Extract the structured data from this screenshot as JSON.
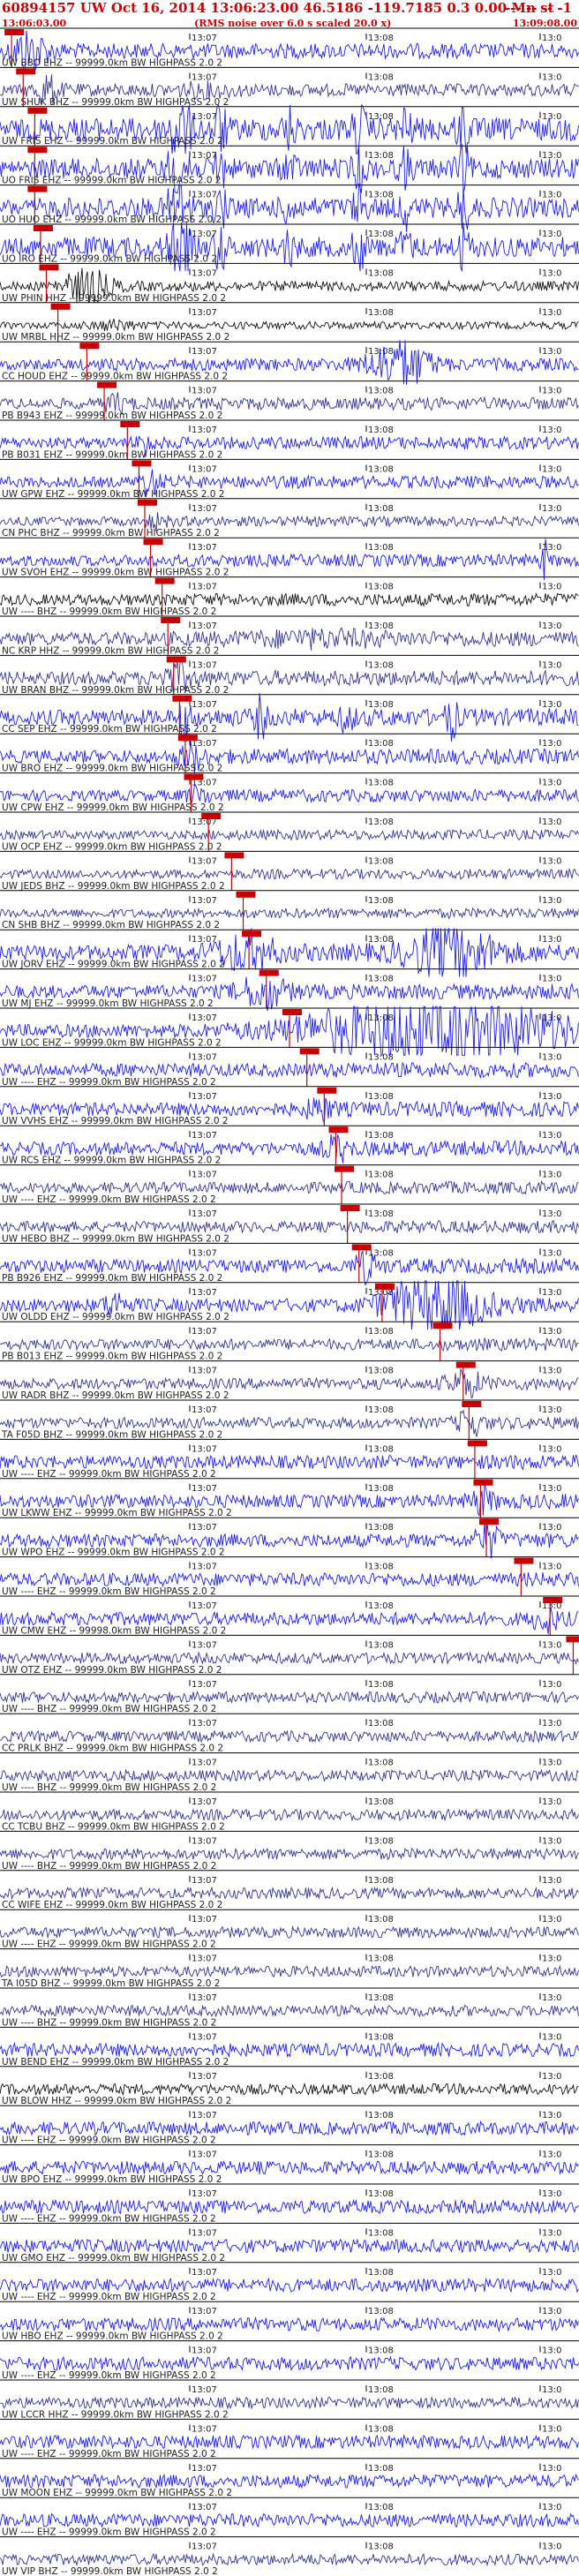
{
  "header": {
    "title": "60894157 UW Oct 16, 2014 13:06:23.00   46.5186 -119.7185  0.3 0.00 Mn st",
    "dashes": "--- -- --   -1",
    "start_time": "13:06:03.00",
    "rms_note": "(RMS noise over 6.0 s scaled 20.0 x)",
    "end_time": "13:09:08.00"
  },
  "chart_data": {
    "type": "seismogram",
    "title": "60894157 UW Oct 16, 2014 13:06:23.00   46.5186 -119.7185  0.3 0.00 Mn st",
    "x_start": "13:06:03.00",
    "x_end": "13:09:08.00",
    "tick_labels": [
      "13:07",
      "13:08",
      "13:0"
    ],
    "colors": {
      "blue": "#1a1aff",
      "navy": "#333399",
      "black": "#111111",
      "pick": "#cc0000"
    },
    "traces": [
      {
        "label": "UW BBO EHZ -- 99999.0km BW  HIGHPASS  2.0  2",
        "color": "blue",
        "amp": 0.6,
        "bursts": [
          [
            0.05,
            0.03,
            3.5
          ]
        ],
        "pick": 0.02
      },
      {
        "label": "UW SHUK BHZ -- 99999.0km BW  HIGHPASS  2.0  2",
        "color": "navy",
        "amp": 0.5,
        "bursts": [
          [
            0.08,
            0.02,
            3.0
          ],
          [
            0.35,
            0.05,
            1.6
          ]
        ],
        "pick": 0.04
      },
      {
        "label": "UW FRIS EHZ -- 99999.0km BW  HIGHPASS  2.0  2",
        "color": "blue",
        "amp": 0.9,
        "bursts": [
          [
            0.3,
            0.01,
            3.5
          ],
          [
            0.32,
            0.01,
            3.5
          ],
          [
            0.38,
            0.01,
            3.0
          ],
          [
            0.5,
            0.01,
            2.5
          ],
          [
            0.62,
            0.01,
            3.0
          ],
          [
            0.7,
            0.01,
            2.5
          ],
          [
            0.8,
            0.01,
            3.0
          ]
        ],
        "pick": 0.06
      },
      {
        "label": "UO FRIS EHZ -- 99999.0km BW  HIGHPASS  2.0  2",
        "color": "blue",
        "amp": 0.8,
        "bursts": [
          [
            0.3,
            0.01,
            3.5
          ],
          [
            0.32,
            0.01,
            3.5
          ],
          [
            0.38,
            0.01,
            3.0
          ],
          [
            0.5,
            0.01,
            2.5
          ],
          [
            0.62,
            0.01,
            3.0
          ],
          [
            0.7,
            0.01,
            2.5
          ],
          [
            0.8,
            0.01,
            3.0
          ]
        ],
        "pick": 0.06
      },
      {
        "label": "UO HUO EHZ -- 99999.0km BW  HIGHPASS  2.0  2",
        "color": "blue",
        "amp": 0.8,
        "bursts": [
          [
            0.3,
            0.01,
            3.5
          ],
          [
            0.32,
            0.01,
            3.5
          ],
          [
            0.38,
            0.01,
            3.0
          ],
          [
            0.5,
            0.01,
            2.5
          ],
          [
            0.62,
            0.01,
            3.0
          ],
          [
            0.7,
            0.01,
            2.5
          ],
          [
            0.8,
            0.01,
            3.0
          ]
        ],
        "pick": 0.06
      },
      {
        "label": "UO IRO EHZ -- 99999.0km BW  HIGHPASS  2.0  2",
        "color": "blue",
        "amp": 0.8,
        "bursts": [
          [
            0.3,
            0.01,
            3.5
          ],
          [
            0.32,
            0.01,
            3.5
          ],
          [
            0.38,
            0.01,
            3.0
          ],
          [
            0.5,
            0.01,
            2.5
          ],
          [
            0.62,
            0.01,
            3.0
          ],
          [
            0.7,
            0.01,
            2.5
          ],
          [
            0.8,
            0.01,
            3.0
          ]
        ],
        "pick": 0.07
      },
      {
        "label": "UW PHIN HHZ -- 99999.0km BW  HIGHPASS  2.0  2",
        "color": "black",
        "amp": 0.4,
        "bursts": [
          [
            0.15,
            0.04,
            4.0
          ]
        ],
        "pick": 0.08
      },
      {
        "label": "UW MRBL HHZ -- 99999.0km BW  HIGHPASS  2.0  2",
        "color": "black",
        "amp": 0.3,
        "bursts": [
          [
            0.2,
            0.03,
            2.0
          ]
        ],
        "pick": 0.1
      },
      {
        "label": "CC HOUD EHZ -- 99999.0km BW  HIGHPASS  2.0  2",
        "color": "blue",
        "amp": 0.5,
        "bursts": [
          [
            0.69,
            0.05,
            4.5
          ]
        ],
        "pick": 0.15
      },
      {
        "label": "PB B943 EHZ -- 99999.0km BW  HIGHPASS  2.0  2",
        "color": "navy",
        "amp": 0.5,
        "bursts": [
          [
            0.2,
            0.02,
            2.0
          ]
        ],
        "pick": 0.18
      },
      {
        "label": "PB B031 EHZ -- 99999.0km BW  HIGHPASS  2.0  2",
        "color": "blue",
        "amp": 0.5,
        "bursts": [
          [
            0.25,
            0.01,
            3.0
          ]
        ],
        "pick": 0.22
      },
      {
        "label": "UW GPW EHZ -- 99999.0km BW  HIGHPASS  2.0  2",
        "color": "blue",
        "amp": 0.5,
        "bursts": [
          [
            0.26,
            0.02,
            2.5
          ]
        ],
        "pick": 0.24
      },
      {
        "label": "CN PHC BHZ -- 99999.0km BW  HIGHPASS  2.0  2",
        "color": "navy",
        "amp": 0.4,
        "bursts": [
          [
            0.27,
            0.02,
            2.0
          ]
        ],
        "pick": 0.25
      },
      {
        "label": "UW SVOH EHZ -- 99999.0km BW  HIGHPASS  2.0  2",
        "color": "blue",
        "amp": 0.5,
        "bursts": [
          [
            0.94,
            0.005,
            4.0
          ]
        ],
        "pick": 0.26
      },
      {
        "label": "UW ---- BHZ -- 99999.0km BW  HIGHPASS  2.0  2",
        "color": "black",
        "amp": 0.5,
        "bursts": [],
        "pick": 0.28
      },
      {
        "label": "NC KRP HHZ -- 99999.0km BW  HIGHPASS  2.0  2",
        "color": "navy",
        "amp": 0.6,
        "bursts": [
          [
            0.55,
            0.1,
            1.6
          ]
        ],
        "pick": 0.29
      },
      {
        "label": "UW BRAN BHZ -- 99999.0km BW  HIGHPASS  2.0  2",
        "color": "navy",
        "amp": 0.6,
        "bursts": [
          [
            0.3,
            0.03,
            2.5
          ]
        ],
        "pick": 0.3
      },
      {
        "label": "CC SEP EHZ -- 99999.0km BW  HIGHPASS  2.0  2",
        "color": "blue",
        "amp": 0.7,
        "bursts": [
          [
            0.32,
            0.01,
            3.5
          ],
          [
            0.45,
            0.01,
            3.0
          ],
          [
            0.6,
            0.01,
            2.5
          ],
          [
            0.78,
            0.01,
            3.0
          ]
        ],
        "pick": 0.31
      },
      {
        "label": "UW BRO EHZ -- 99999.0km BW  HIGHPASS  2.0  2",
        "color": "blue",
        "amp": 0.6,
        "bursts": [
          [
            0.33,
            0.02,
            2.5
          ]
        ],
        "pick": 0.32
      },
      {
        "label": "UW CPW EHZ -- 99999.0km BW  HIGHPASS  2.0  2",
        "color": "blue",
        "amp": 0.5,
        "bursts": [
          [
            0.34,
            0.02,
            2.0
          ]
        ],
        "pick": 0.33
      },
      {
        "label": "UW OCP EHZ -- 99999.0km BW  HIGHPASS  2.0  2",
        "color": "navy",
        "amp": 0.4,
        "bursts": [],
        "pick": 0.36
      },
      {
        "label": "UW JEDS BHZ -- 99999.0km BW  HIGHPASS  2.0  2",
        "color": "navy",
        "amp": 0.4,
        "bursts": [],
        "pick": 0.4
      },
      {
        "label": "CN SHB BHZ -- 99999.0km BW  HIGHPASS  2.0  2",
        "color": "navy",
        "amp": 0.4,
        "bursts": [],
        "pick": 0.42
      },
      {
        "label": "UW JORV EHZ -- 99999.0km BW  HIGHPASS  2.0  2",
        "color": "blue",
        "amp": 0.7,
        "bursts": [
          [
            0.42,
            0.05,
            3.0
          ],
          [
            0.78,
            0.07,
            4.0
          ]
        ],
        "pick": 0.43
      },
      {
        "label": "UW MJ EHZ -- 99999.0km BW  HIGHPASS  2.0  2",
        "color": "blue",
        "amp": 0.6,
        "bursts": [
          [
            0.45,
            0.04,
            3.0
          ]
        ],
        "pick": 0.46
      },
      {
        "label": "UW LOC EHZ -- 99999.0km BW  HIGHPASS  2.0  2",
        "color": "blue",
        "amp": 0.6,
        "bursts": [
          [
            0.75,
            0.22,
            5.0
          ]
        ],
        "pick": 0.5
      },
      {
        "label": "UW ---- EHZ -- 99999.0km BW  HIGHPASS  2.0  2",
        "color": "blue",
        "amp": 0.6,
        "bursts": [],
        "pick": 0.53
      },
      {
        "label": "UW VVHS EHZ -- 99999.0km BW  HIGHPASS  2.0  2",
        "color": "blue",
        "amp": 0.6,
        "bursts": [
          [
            0.55,
            0.02,
            2.5
          ]
        ],
        "pick": 0.56
      },
      {
        "label": "UW RCS EHZ -- 99999.0km BW  HIGHPASS  2.0  2",
        "color": "blue",
        "amp": 0.6,
        "bursts": [
          [
            0.58,
            0.02,
            2.5
          ]
        ],
        "pick": 0.58
      },
      {
        "label": "UW ---- EHZ -- 99999.0km BW  HIGHPASS  2.0  2",
        "color": "navy",
        "amp": 0.5,
        "bursts": [],
        "pick": 0.59
      },
      {
        "label": "UW HEBO BHZ -- 99999.0km BW  HIGHPASS  2.0  2",
        "color": "navy",
        "amp": 0.5,
        "bursts": [],
        "pick": 0.6
      },
      {
        "label": "PB B926 EHZ -- 99999.0km BW  HIGHPASS  2.0  2",
        "color": "blue",
        "amp": 0.6,
        "bursts": [
          [
            0.63,
            0.02,
            2.5
          ]
        ],
        "pick": 0.62
      },
      {
        "label": "UW OLDD EHZ -- 99999.0km BW  HIGHPASS  2.0  2",
        "color": "blue",
        "amp": 0.6,
        "bursts": [
          [
            0.2,
            0.02,
            2.5
          ],
          [
            0.75,
            0.08,
            5.0
          ]
        ],
        "pick": 0.66
      },
      {
        "label": "PB B013 EHZ -- 99999.0km BW  HIGHPASS  2.0  2",
        "color": "navy",
        "amp": 0.5,
        "bursts": [],
        "pick": 0.76
      },
      {
        "label": "UW RADR BHZ -- 99999.0km BW  HIGHPASS  2.0  2",
        "color": "navy",
        "amp": 0.5,
        "bursts": [
          [
            0.8,
            0.03,
            3.0
          ]
        ],
        "pick": 0.8
      },
      {
        "label": "TA F05D BHZ -- 99999.0km BW  HIGHPASS  2.0  2",
        "color": "navy",
        "amp": 0.5,
        "bursts": [
          [
            0.81,
            0.02,
            3.0
          ]
        ],
        "pick": 0.81
      },
      {
        "label": "UW ---- EHZ -- 99999.0km BW  HIGHPASS  2.0  2",
        "color": "blue",
        "amp": 0.6,
        "bursts": [],
        "pick": 0.82
      },
      {
        "label": "UW LKWW EHZ -- 99999.0km BW  HIGHPASS  2.0  2",
        "color": "blue",
        "amp": 0.6,
        "bursts": [
          [
            0.83,
            0.02,
            2.5
          ]
        ],
        "pick": 0.83
      },
      {
        "label": "UW WPO EHZ -- 99999.0km BW  HIGHPASS  2.0  2",
        "color": "blue",
        "amp": 0.6,
        "bursts": [
          [
            0.84,
            0.02,
            3.0
          ]
        ],
        "pick": 0.84
      },
      {
        "label": "UW ---- EHZ -- 99999.0km BW  HIGHPASS  2.0  2",
        "color": "blue",
        "amp": 0.6,
        "bursts": [],
        "pick": 0.9
      },
      {
        "label": "UW CMW EHZ -- 99998.0km BW  HIGHPASS  2.0  2",
        "color": "blue",
        "amp": 0.6,
        "bursts": [
          [
            0.94,
            0.02,
            2.5
          ]
        ],
        "pick": 0.95
      },
      {
        "label": "UW OTZ EHZ -- 99999.0km BW  HIGHPASS  2.0  2",
        "color": "navy",
        "amp": 0.5,
        "bursts": [],
        "pick": 0.99
      },
      {
        "label": "UW ---- BHZ -- 99999.0km BW  HIGHPASS  2.0  2",
        "color": "navy",
        "amp": 0.5,
        "bursts": [],
        "pick": null
      },
      {
        "label": "CC PRLK BHZ -- 99999.0km BW  HIGHPASS  2.0  2",
        "color": "navy",
        "amp": 0.5,
        "bursts": [],
        "pick": null
      },
      {
        "label": "UW ---- BHZ -- 99999.0km BW  HIGHPASS  2.0  2",
        "color": "navy",
        "amp": 0.5,
        "bursts": [],
        "pick": null
      },
      {
        "label": "CC TCBU BHZ -- 99999.0km BW  HIGHPASS  2.0  2",
        "color": "navy",
        "amp": 0.5,
        "bursts": [],
        "pick": null
      },
      {
        "label": "UW ---- BHZ -- 99999.0km BW  HIGHPASS  2.0  2",
        "color": "navy",
        "amp": 0.5,
        "bursts": [],
        "pick": null
      },
      {
        "label": "CC WIFE EHZ -- 99999.0km BW  HIGHPASS  2.0  2",
        "color": "navy",
        "amp": 0.5,
        "bursts": [],
        "pick": null
      },
      {
        "label": "UW ---- EHZ -- 99999.0km BW  HIGHPASS  2.0  2",
        "color": "navy",
        "amp": 0.5,
        "bursts": [],
        "pick": null
      },
      {
        "label": "TA I05D BHZ -- 99999.0km BW  HIGHPASS  2.0  2",
        "color": "navy",
        "amp": 0.5,
        "bursts": [],
        "pick": null
      },
      {
        "label": "UW ---- BHZ -- 99999.0km BW  HIGHPASS  2.0  2",
        "color": "navy",
        "amp": 0.5,
        "bursts": [],
        "pick": null
      },
      {
        "label": "UW BEND EHZ -- 99999.0km BW  HIGHPASS  2.0  2",
        "color": "blue",
        "amp": 0.6,
        "bursts": [],
        "pick": null
      },
      {
        "label": "UW BLOW HHZ -- 99999.0km BW  HIGHPASS  2.0  2",
        "color": "black",
        "amp": 0.5,
        "bursts": [],
        "pick": null
      },
      {
        "label": "UW ---- EHZ -- 99999.0km BW  HIGHPASS  2.0  2",
        "color": "blue",
        "amp": 0.6,
        "bursts": [],
        "pick": null
      },
      {
        "label": "UW BPO EHZ -- 99999.0km BW  HIGHPASS  2.0  2",
        "color": "blue",
        "amp": 0.6,
        "bursts": [],
        "pick": null
      },
      {
        "label": "UW ---- EHZ -- 99999.0km BW  HIGHPASS  2.0  2",
        "color": "blue",
        "amp": 0.6,
        "bursts": [],
        "pick": null
      },
      {
        "label": "UW GMO EHZ -- 99999.0km BW  HIGHPASS  2.0  2",
        "color": "blue",
        "amp": 0.6,
        "bursts": [],
        "pick": null
      },
      {
        "label": "UW ---- EHZ -- 99999.0km BW  HIGHPASS  2.0  2",
        "color": "blue",
        "amp": 0.6,
        "bursts": [],
        "pick": null
      },
      {
        "label": "UW HBO EHZ -- 99999.0km BW  HIGHPASS  2.0  2",
        "color": "blue",
        "amp": 0.6,
        "bursts": [],
        "pick": null
      },
      {
        "label": "UW ---- EHZ -- 99999.0km BW  HIGHPASS  2.0  2",
        "color": "blue",
        "amp": 0.6,
        "bursts": [],
        "pick": null
      },
      {
        "label": "UW LCCR HHZ -- 99999.0km BW  HIGHPASS  2.0  2",
        "color": "navy",
        "amp": 0.5,
        "bursts": [],
        "pick": null
      },
      {
        "label": "UW ---- EHZ -- 99999.0km BW  HIGHPASS  2.0  2",
        "color": "blue",
        "amp": 0.6,
        "bursts": [],
        "pick": null
      },
      {
        "label": "UW MOON EHZ -- 99999.0km BW  HIGHPASS  2.0  2",
        "color": "blue",
        "amp": 0.6,
        "bursts": [],
        "pick": null
      },
      {
        "label": "UW ---- EHZ -- 99999.0km BW  HIGHPASS  2.0  2",
        "color": "blue",
        "amp": 0.6,
        "bursts": [],
        "pick": null
      },
      {
        "label": "UW VIP BHZ -- 99999.0km BW  HIGHPASS  2.0  2",
        "color": "navy",
        "amp": 0.5,
        "bursts": [],
        "pick": null
      }
    ]
  }
}
